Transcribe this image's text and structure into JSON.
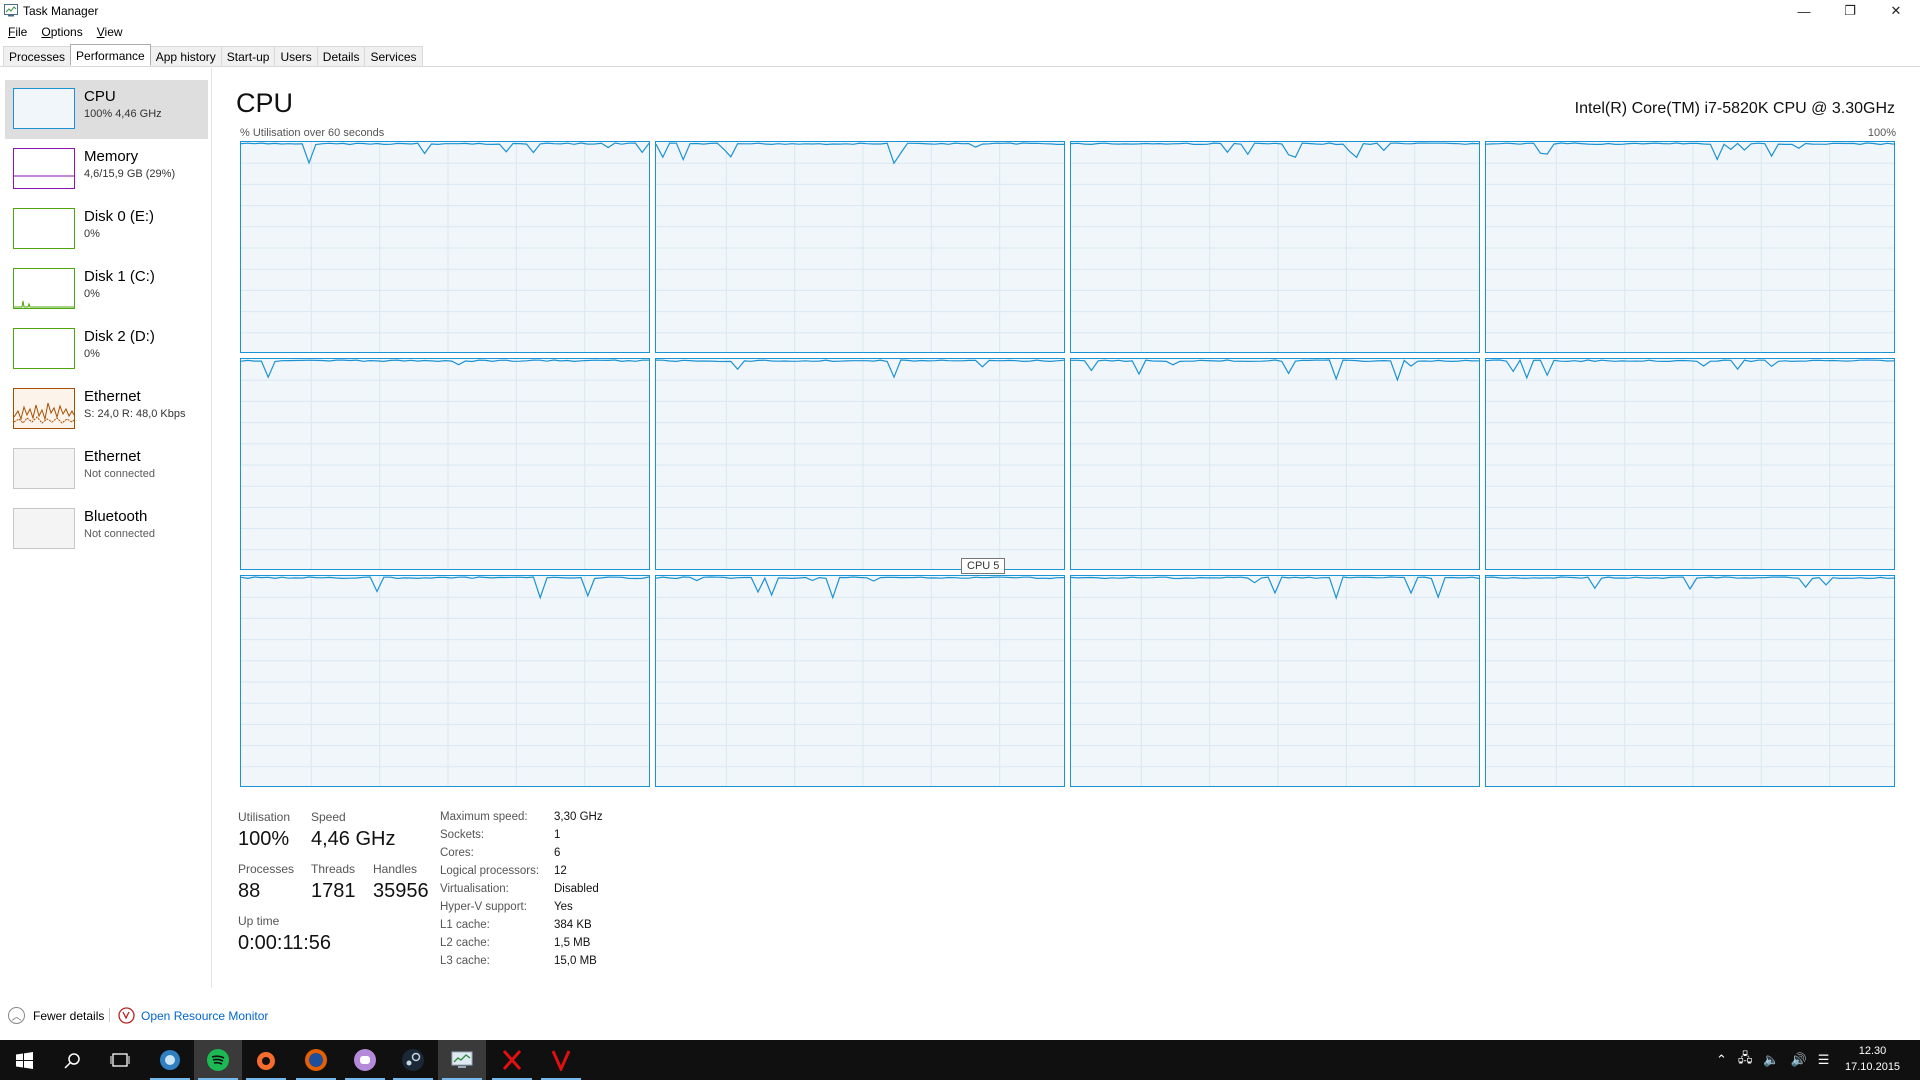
{
  "window": {
    "title": "Task Manager",
    "minimize": "—",
    "maximize": "❐",
    "close": "✕"
  },
  "menu": [
    "File",
    "Options",
    "View"
  ],
  "tabs": [
    {
      "label": "Processes"
    },
    {
      "label": "Performance",
      "active": true
    },
    {
      "label": "App history"
    },
    {
      "label": "Start-up"
    },
    {
      "label": "Users"
    },
    {
      "label": "Details"
    },
    {
      "label": "Services"
    }
  ],
  "sidebar": {
    "items": [
      {
        "name": "CPU",
        "detail": "100% 4,46 GHz",
        "color": "#1b93d2",
        "selected": true
      },
      {
        "name": "Memory",
        "detail": "4,6/15,9 GB (29%)",
        "color": "#8b12ae"
      },
      {
        "name": "Disk 0 (E:)",
        "detail": "0%",
        "color": "#4da60c"
      },
      {
        "name": "Disk 1 (C:)",
        "detail": "0%",
        "color": "#4da60c"
      },
      {
        "name": "Disk 2 (D:)",
        "detail": "0%",
        "color": "#4da60c"
      },
      {
        "name": "Ethernet",
        "detail": "S: 24,0  R: 48,0 Kbps",
        "color": "#a74f01"
      },
      {
        "name": "Ethernet",
        "detail": "Not connected",
        "color": "#c8c8c8",
        "dim": true
      },
      {
        "name": "Bluetooth",
        "detail": "Not connected",
        "color": "#c8c8c8",
        "dim": true
      }
    ]
  },
  "main": {
    "title": "CPU",
    "cpu_model": "Intel(R) Core(TM) i7-5820K CPU @ 3.30GHz",
    "util_caption": "% Utilisation over 60 seconds",
    "util_max": "100%",
    "graph_color": "#1b93d2",
    "tooltip": "CPU 5",
    "logical_processor_count": 12
  },
  "stats": {
    "utilisation_label": "Utilisation",
    "utilisation": "100%",
    "speed_label": "Speed",
    "speed": "4,46 GHz",
    "processes_label": "Processes",
    "processes": "88",
    "threads_label": "Threads",
    "threads": "1781",
    "handles_label": "Handles",
    "handles": "35956",
    "uptime_label": "Up time",
    "uptime": "0:00:11:56"
  },
  "specs": [
    {
      "key": "Maximum speed:",
      "value": "3,30 GHz"
    },
    {
      "key": "Sockets:",
      "value": "1"
    },
    {
      "key": "Cores:",
      "value": "6"
    },
    {
      "key": "Logical processors:",
      "value": "12"
    },
    {
      "key": "Virtualisation:",
      "value": "Disabled"
    },
    {
      "key": "Hyper-V support:",
      "value": "Yes"
    },
    {
      "key": "L1 cache:",
      "value": "384 KB"
    },
    {
      "key": "L2 cache:",
      "value": "1,5 MB"
    },
    {
      "key": "L3 cache:",
      "value": "15,0 MB"
    }
  ],
  "footer": {
    "fewer_details": "Fewer details",
    "open_resmon": "Open Resource Monitor"
  },
  "taskbar": {
    "icons": [
      "windows-start-icon",
      "search-icon",
      "task-view-icon",
      "steam-like-icon",
      "spotify-icon",
      "origin-icon",
      "firefox-icon",
      "discord-icon",
      "steam-icon",
      "task-manager-icon",
      "app-x-icon",
      "app-v-icon"
    ],
    "clock_time": "12.30",
    "clock_date": "17.10.2015"
  }
}
